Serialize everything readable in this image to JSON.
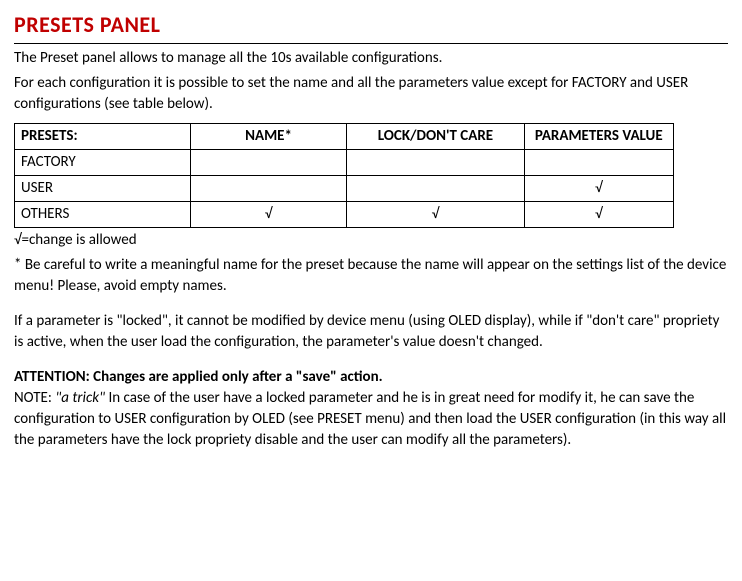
{
  "title": "PRESETS PANEL",
  "intro_line1": "The Preset panel allows to manage all the 10s available configurations.",
  "intro_line2": "For each configuration it is possible to set the name and all the parameters value except for FACTORY and USER configurations (see table below).",
  "table": {
    "headers": {
      "c0": "PRESETS:",
      "c1": "NAME*",
      "c2": "LOCK/DON'T CARE",
      "c3": "PARAMETERS VALUE"
    },
    "rows": [
      {
        "c0": "FACTORY",
        "c1": "",
        "c2": "",
        "c3": ""
      },
      {
        "c0": "USER",
        "c1": "",
        "c2": "",
        "c3": "√"
      },
      {
        "c0": "OTHERS",
        "c1": "√",
        "c2": "√",
        "c3": "√"
      }
    ]
  },
  "legend": "√=change is allowed",
  "footnote": "* Be careful to write a meaningful name for the preset because the name will appear on the settings list of the device menu! Please, avoid empty names.",
  "locked_para": "If a parameter is \"locked\", it cannot be modified by device menu (using OLED display), while if \"don't care\" propriety is active, when the user load the configuration, the parameter's value doesn't changed.",
  "attention": "ATTENTION: Changes are applied only after a \"save\" action.",
  "note_prefix": "NOTE: ",
  "note_italic": "\"a trick\"",
  "note_rest": " In case of the user have a locked parameter and he is in great need for modify it, he can save the configuration to USER configuration by OLED (see PRESET menu) and then load the USER configuration (in this way all the parameters have the lock propriety disable and the user can modify all the parameters)."
}
